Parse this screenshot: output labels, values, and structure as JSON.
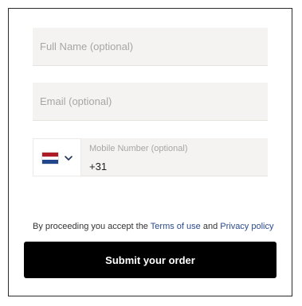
{
  "form": {
    "full_name": {
      "placeholder": "Full Name (optional)",
      "value": ""
    },
    "email": {
      "placeholder": "Email (optional)",
      "value": ""
    },
    "phone": {
      "label": "Mobile Number (optional)",
      "value": "+31",
      "country_flag": "netherlands-flag-icon",
      "flag_colors": [
        "#ae1c28",
        "#ffffff",
        "#21468b"
      ],
      "dropdown_icon": "chevron-down-icon"
    }
  },
  "consent": {
    "prefix": "By proceeding you accept the",
    "terms_link": "Terms of use",
    "conjunction": "and",
    "privacy_link": "Privacy policy",
    "link_color": "#2b4a8c"
  },
  "submit": {
    "label": "Submit your order",
    "color": "#000000"
  }
}
